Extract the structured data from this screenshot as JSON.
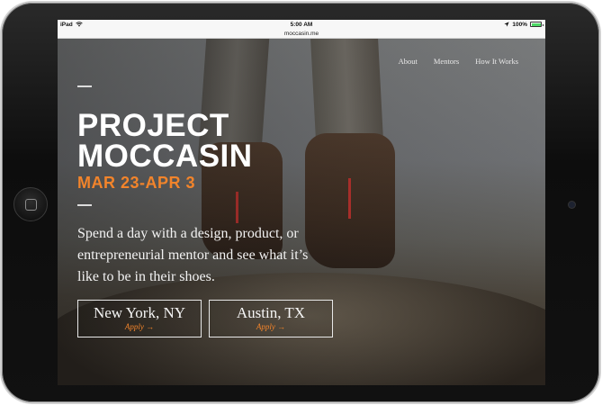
{
  "status_bar": {
    "device": "iPad",
    "time": "5:00 AM",
    "battery": "100%"
  },
  "browser": {
    "url": "moccasin.me"
  },
  "nav": {
    "items": [
      {
        "label": "About"
      },
      {
        "label": "Mentors"
      },
      {
        "label": "How It Works"
      }
    ]
  },
  "hero": {
    "title_line1": "PROJECT",
    "title_line2": "MOCCASIN",
    "dates": "MAR 23-APR 3",
    "tagline": "Spend a day with a design, product, or entrepreneurial mentor and see what it’s like to be in their shoes."
  },
  "cities": [
    {
      "name": "New York, NY",
      "apply_label": "Apply →"
    },
    {
      "name": "Austin, TX",
      "apply_label": "Apply →"
    }
  ],
  "colors": {
    "accent": "#f2842b",
    "text": "#ffffff"
  }
}
